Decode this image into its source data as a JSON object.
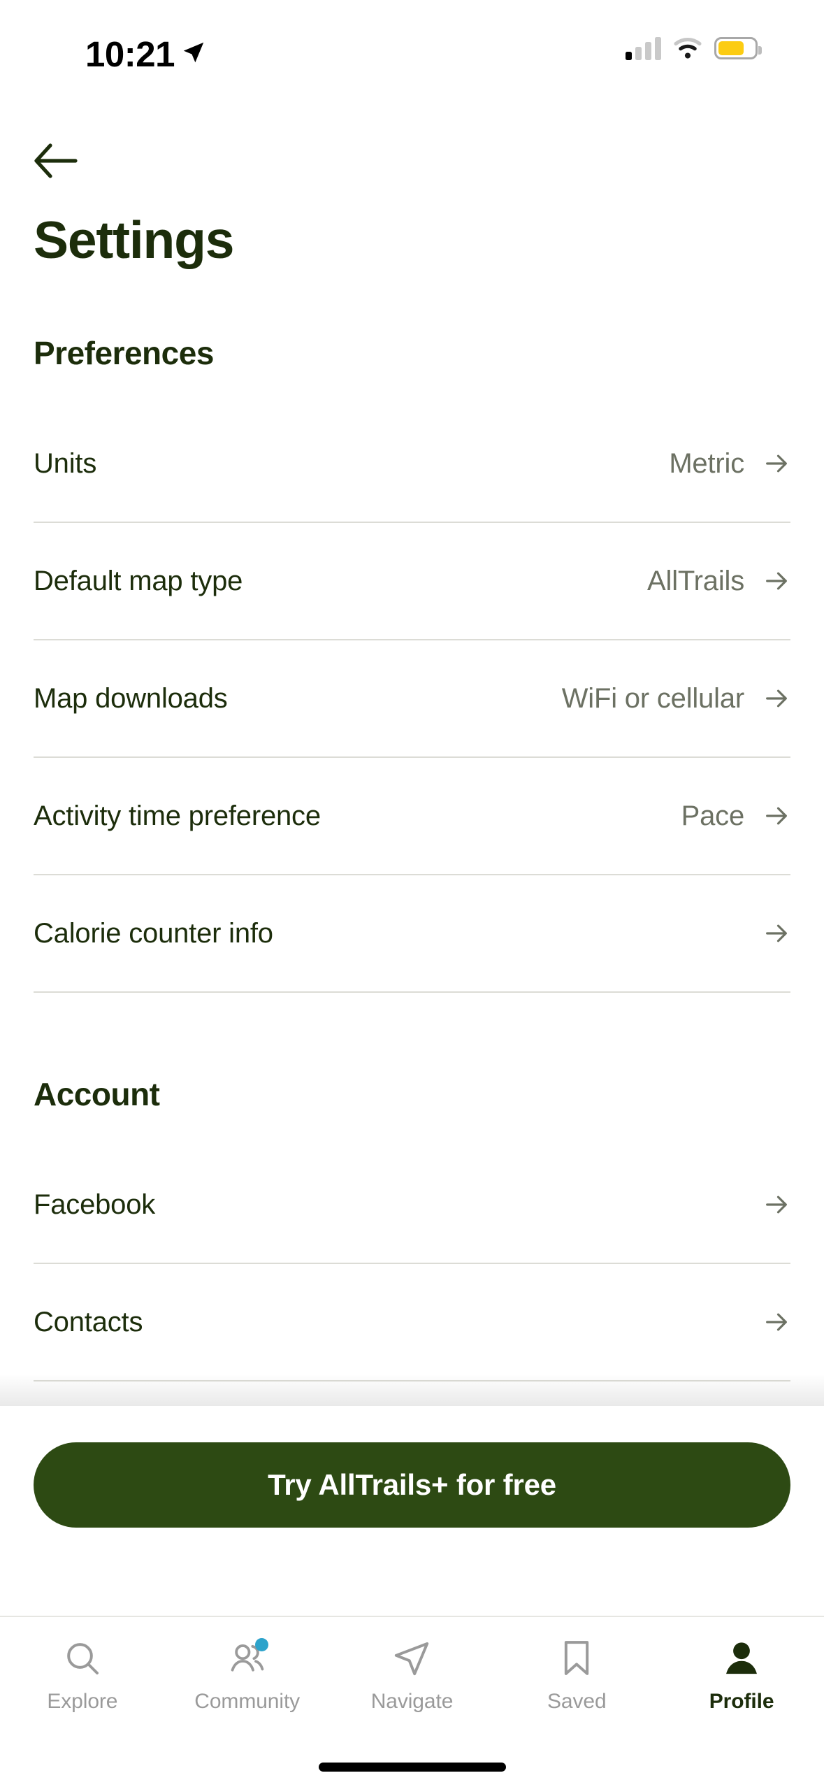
{
  "status_bar": {
    "time": "10:21",
    "location_arrow_icon": "location-arrow-icon",
    "cellular_icon": "cellular-signal-icon",
    "wifi_icon": "wifi-icon",
    "battery_icon": "battery-low-power-icon",
    "battery_color": "#FCCC12"
  },
  "header": {
    "back_icon": "arrow-left-icon",
    "title": "Settings"
  },
  "theme": {
    "brand_green": "#1C2D0B",
    "cta_green": "#2D4A13",
    "muted_text": "#6C7163",
    "divider": "#DCDCD6",
    "badge_blue": "#2DA3CB"
  },
  "sections": [
    {
      "heading": "Preferences",
      "rows": [
        {
          "label": "Units",
          "value": "Metric",
          "arrow_icon": "arrow-right-icon"
        },
        {
          "label": "Default map type",
          "value": "AllTrails",
          "arrow_icon": "arrow-right-icon"
        },
        {
          "label": "Map downloads",
          "value": "WiFi or cellular",
          "arrow_icon": "arrow-right-icon"
        },
        {
          "label": "Activity time preference",
          "value": "Pace",
          "arrow_icon": "arrow-right-icon"
        },
        {
          "label": "Calorie counter info",
          "value": "",
          "arrow_icon": "arrow-right-icon"
        }
      ]
    },
    {
      "heading": "Account",
      "rows": [
        {
          "label": "Facebook",
          "value": "",
          "arrow_icon": "arrow-right-icon"
        },
        {
          "label": "Contacts",
          "value": "",
          "arrow_icon": "arrow-right-icon"
        }
      ]
    }
  ],
  "cta": {
    "label": "Try AllTrails+ for free"
  },
  "tab_bar": {
    "tabs": [
      {
        "label": "Explore",
        "icon": "search-icon",
        "active": false,
        "badge": false
      },
      {
        "label": "Community",
        "icon": "people-icon",
        "active": false,
        "badge": true
      },
      {
        "label": "Navigate",
        "icon": "paper-plane-icon",
        "active": false,
        "badge": false
      },
      {
        "label": "Saved",
        "icon": "bookmark-icon",
        "active": false,
        "badge": false
      },
      {
        "label": "Profile",
        "icon": "person-filled-icon",
        "active": true,
        "badge": false
      }
    ]
  }
}
